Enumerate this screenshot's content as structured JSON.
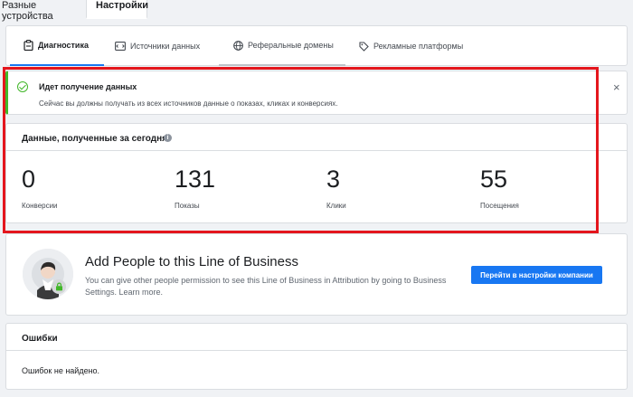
{
  "top_tabs": [
    {
      "label": "Разные устройства"
    },
    {
      "label": "Настройки"
    }
  ],
  "sub_tabs": [
    {
      "label": "Диагностика",
      "icon": "diagnostics-icon"
    },
    {
      "label": "Источники данных",
      "icon": "data-sources-icon"
    },
    {
      "label": "Реферальные домены",
      "icon": "globe-icon"
    },
    {
      "label": "Рекламные платформы",
      "icon": "tag-icon"
    }
  ],
  "alert": {
    "title": "Идет получение данных",
    "text": "Сейчас вы должны получать из всех источников данные о показах, кликах и конверсиях.",
    "close": "×",
    "status_color": "#42b72a"
  },
  "stats": {
    "heading": "Данные, полученные за сегодня",
    "info_icon": "i",
    "items": [
      {
        "value": "0",
        "label": "Конверсии"
      },
      {
        "value": "131",
        "label": "Показы"
      },
      {
        "value": "3",
        "label": "Клики"
      },
      {
        "value": "55",
        "label": "Посещения"
      }
    ]
  },
  "people": {
    "heading": "Add People to this Line of Business",
    "description": "You can give other people permission to see this Line of Business in Attribution by going to Business Settings. Learn more.",
    "button": "Перейти в настройки компании"
  },
  "errors": {
    "heading": "Ошибки",
    "empty_text": "Ошибок не найдено."
  },
  "colors": {
    "accent": "#1877f2",
    "highlight": "#e4161d",
    "success": "#42b72a"
  }
}
